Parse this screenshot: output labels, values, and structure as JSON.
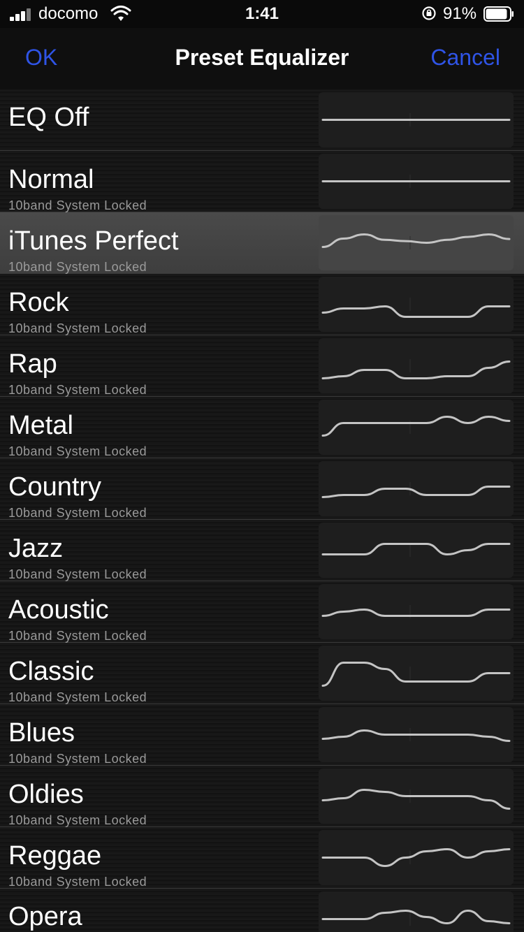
{
  "status_bar": {
    "carrier": "docomo",
    "time": "1:41",
    "battery_percent": "91%",
    "battery_level": 0.91
  },
  "nav": {
    "ok_label": "OK",
    "title": "Preset Equalizer",
    "cancel_label": "Cancel"
  },
  "accent_color": "#2f54e6",
  "selected_index": 2,
  "presets": [
    {
      "name": "EQ Off",
      "subtitle": "",
      "curve": [
        0,
        0,
        0,
        0,
        0,
        0,
        0,
        0,
        0,
        0
      ]
    },
    {
      "name": "Normal",
      "subtitle": "10band System Locked",
      "curve": [
        0,
        0,
        0,
        0,
        0,
        0,
        0,
        0,
        0,
        0
      ]
    },
    {
      "name": "iTunes Perfect",
      "subtitle": "10band System Locked",
      "curve": [
        -1,
        1,
        2,
        0.7,
        0.4,
        0,
        0.7,
        1.4,
        2,
        0.9
      ]
    },
    {
      "name": "Rock",
      "subtitle": "10band System Locked",
      "curve": [
        -2,
        -1,
        -1,
        -0.5,
        -3,
        -3,
        -3,
        -3,
        -0.5,
        -0.5
      ]
    },
    {
      "name": "Rap",
      "subtitle": "10band System Locked",
      "curve": [
        -3,
        -2.5,
        -1,
        -1,
        -3,
        -3,
        -2.5,
        -2.5,
        -0.5,
        1
      ]
    },
    {
      "name": "Metal",
      "subtitle": "10band System Locked",
      "curve": [
        -2,
        1,
        1,
        1,
        1,
        1,
        2.5,
        1,
        2.5,
        1.5
      ]
    },
    {
      "name": "Country",
      "subtitle": "10band System Locked",
      "curve": [
        -2,
        -1.5,
        -1.5,
        0,
        0,
        -1.5,
        -1.5,
        -1.5,
        0.5,
        0.5
      ]
    },
    {
      "name": "Jazz",
      "subtitle": "10band System Locked",
      "curve": [
        -1,
        -1,
        -1,
        1.5,
        1.5,
        1.5,
        -1,
        0,
        1.5,
        1.5
      ]
    },
    {
      "name": "Acoustic",
      "subtitle": "10band System Locked",
      "curve": [
        -1,
        0,
        0.5,
        -1,
        -1,
        -1,
        -1,
        -1,
        0.5,
        0.5
      ]
    },
    {
      "name": "Classic",
      "subtitle": "10band System Locked",
      "curve": [
        -3,
        2.5,
        2.5,
        1,
        -2,
        -2,
        -2,
        -2,
        0,
        0
      ]
    },
    {
      "name": "Blues",
      "subtitle": "10band System Locked",
      "curve": [
        -1,
        -0.5,
        1,
        0,
        0,
        0,
        0,
        0,
        -0.5,
        -1.5
      ]
    },
    {
      "name": "Oldies",
      "subtitle": "10band System Locked",
      "curve": [
        -1,
        -0.5,
        1.5,
        1,
        0,
        0,
        0,
        0,
        -1,
        -3
      ]
    },
    {
      "name": "Reggae",
      "subtitle": "10band System Locked",
      "curve": [
        0,
        0,
        0,
        -2,
        0,
        1.5,
        2,
        0,
        1.5,
        2
      ]
    },
    {
      "name": "Opera",
      "subtitle": "",
      "curve": [
        0,
        0,
        0,
        1.5,
        2,
        0.5,
        -1,
        2,
        -0.5,
        -1
      ]
    }
  ]
}
